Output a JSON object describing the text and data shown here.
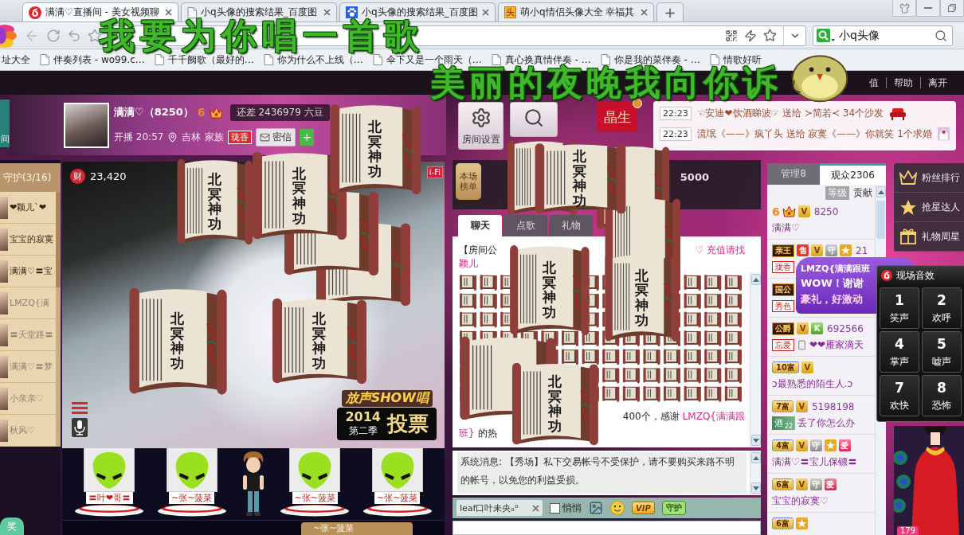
{
  "lyrics": [
    {
      "text": "我要为你唱一首歌"
    },
    {
      "text": "美丽的夜晚我向你诉"
    }
  ],
  "browser": {
    "tabs": [
      {
        "title": "满满♡直播间 - 美女视频聊",
        "kind": "live",
        "selected": true
      },
      {
        "title": "小q头像的搜索结果_百度图",
        "kind": "page",
        "selected": false
      },
      {
        "title": "小q头像的搜索结果_百度图",
        "kind": "paw",
        "selected": false
      },
      {
        "title": "萌小q情侣头像大全 幸福其",
        "kind": "glyph",
        "favicon": "头",
        "selected": false
      }
    ],
    "new_tab": "+",
    "search": {
      "value": "小q头像"
    },
    "bookmarks": [
      {
        "title": "址大全",
        "kind": "plain"
      },
      {
        "title": "伴奏列表 - wo99.c…",
        "kind": "page"
      },
      {
        "title": "千千阙歌（最好的…",
        "kind": "page"
      },
      {
        "title": "你为什么不上线（…",
        "kind": "page"
      },
      {
        "title": "伞下又是一个雨天（…",
        "kind": "page"
      },
      {
        "title": "真心换真情伴奏 - …",
        "kind": "page"
      },
      {
        "title": "你是我的菜伴奏 - …",
        "kind": "page"
      },
      {
        "title": "情歌好听",
        "kind": "page"
      }
    ]
  },
  "nav_links": [
    "值",
    "帮助",
    "离开"
  ],
  "side_tab": "间",
  "host": {
    "name": "满满♡（8250）",
    "level": "6",
    "gap_text": "还差 2436979 六豆",
    "started": "开播 20:57",
    "location": "吉林",
    "family_label": "家族",
    "family_badge": "珑香",
    "message_button": "密信",
    "follow_button": "+"
  },
  "room_buttons": [
    {
      "kind": "settings",
      "label": "房间设置"
    },
    {
      "kind": "search"
    }
  ],
  "star_banner": "晶生",
  "gift_feed": [
    {
      "time": "22:23",
      "text": "☜安迪❤饮酒睇波☞ 送给 ≻简若≺ 34个沙发",
      "kind": "sofa"
    },
    {
      "time": "22:23",
      "text": "流氓《——》疯丫头 送给 寂寞《——》你就笑 1个求婚",
      "kind": "veil"
    }
  ],
  "guards": {
    "title": "守护(3/16)",
    "items": [
      {
        "name": "❤颖儿`❤",
        "online": true
      },
      {
        "name": "宝宝的寂寞",
        "online": true
      },
      {
        "name": "满满♡〓宝",
        "online": true
      },
      {
        "name": "LMZQ{满",
        "online": false
      },
      {
        "name": "〓天堂路〓",
        "online": false
      },
      {
        "name": "满满♡〓梦",
        "online": false
      },
      {
        "name": "小亲亲♡",
        "online": false
      },
      {
        "name": "秋风♡",
        "online": false
      }
    ]
  },
  "award_badge": "奖",
  "video": {
    "wealth_label": "财",
    "wealth": "23,420",
    "wifi_badge": "i-Fi",
    "promo": {
      "title": "放声SHOW唱",
      "year": "2014",
      "season": "第二季",
      "action": "投票"
    }
  },
  "seats": [
    {
      "kind": "alien",
      "name": "〓叶❤哥〓"
    },
    {
      "kind": "alien",
      "name": "~张~菠菜"
    },
    {
      "kind": "character"
    },
    {
      "kind": "alien",
      "name": "~张~菠菜"
    },
    {
      "kind": "alien",
      "name": "~张~菠菜"
    }
  ],
  "hover_name": "~张~菠菜",
  "ranking": {
    "tag": "本场榜单",
    "value": "5000"
  },
  "chat": {
    "tabs": [
      {
        "label": "聊天",
        "selected": true
      },
      {
        "label": "点歌",
        "selected": false
      },
      {
        "label": "礼物",
        "selected": false
      }
    ],
    "notice": {
      "start": "【房间公",
      "end": "♡ 充值请找",
      "next_line": "颖儿"
    },
    "thanks": {
      "text": "400个，感谢",
      "name": "LMZQ{满满跟",
      "name_end": "班}",
      "tail": "的热"
    },
    "system": "系统消息: 【秀场】私下交易帐号不受保护，请不要购买来路不明的帐号，以免您的利益受损。",
    "recipient": "leaf口叶未央ₒ⁰",
    "whisper": {
      "label": "悄悄",
      "checked": false
    },
    "vip_button": "VIP",
    "guard_button": "守护"
  },
  "audience": {
    "tabs": [
      {
        "label": "管理8",
        "selected": false
      },
      {
        "label": "观众2306",
        "selected": true
      }
    ],
    "sort": [
      {
        "label": "等级",
        "selected": true
      },
      {
        "label": "贡献",
        "selected": false
      }
    ],
    "users": [
      {
        "badges": [
          {
            "kind": "crown",
            "text": "6"
          },
          {
            "kind": "vip",
            "text": "V"
          }
        ],
        "score": "8250",
        "name": "满满♡"
      },
      {
        "badges": [
          {
            "kind": "noble",
            "text": "亲王"
          },
          {
            "kind": "sell",
            "text": "售"
          },
          {
            "kind": "vip",
            "text": "V"
          },
          {
            "kind": "guard",
            "text": "守"
          },
          {
            "kind": "star"
          }
        ],
        "score": "21",
        "tags": [
          {
            "kind": "family",
            "text": "珑香"
          }
        ]
      },
      {
        "badges": [
          {
            "kind": "noble",
            "text": "国公"
          }
        ],
        "tags": [
          {
            "kind": "family",
            "text": "秀色"
          }
        ]
      },
      {
        "badges": [
          {
            "kind": "noble",
            "text": "公爵"
          },
          {
            "kind": "vip",
            "text": "V"
          },
          {
            "kind": "k",
            "text": "K"
          }
        ],
        "score": "692566",
        "tags": [
          {
            "kind": "family",
            "text": "忘爱"
          },
          {
            "kind": "phone"
          }
        ],
        "name": "❤❤雁家滴天"
      },
      {
        "badges": [
          {
            "kind": "rich",
            "text": "10富"
          },
          {
            "kind": "vip",
            "text": "V"
          }
        ],
        "name": "ↄ最熟悉的陌生人.ↄ"
      },
      {
        "badges": [
          {
            "kind": "rich",
            "text": "7富"
          },
          {
            "kind": "vip",
            "text": "V"
          }
        ],
        "score": "5198198",
        "tags": [
          {
            "kind": "card",
            "text": "酒",
            "count": "22"
          }
        ],
        "name": "丢了你怎么办"
      },
      {
        "badges": [
          {
            "kind": "rich",
            "text": "4富"
          },
          {
            "kind": "vip",
            "text": "V"
          },
          {
            "kind": "guard",
            "text": "守"
          },
          {
            "kind": "star"
          },
          {
            "kind": "love",
            "text": "爱"
          }
        ],
        "name": "满满♡〓宝儿保镖〓"
      },
      {
        "badges": [
          {
            "kind": "rich",
            "text": "6富"
          },
          {
            "kind": "vip",
            "text": "V"
          },
          {
            "kind": "guard",
            "text": "守"
          },
          {
            "kind": "love",
            "text": "爱"
          }
        ],
        "name": "宝宝的寂寞♡"
      },
      {
        "badges": [
          {
            "kind": "rich",
            "text": "6富"
          },
          {
            "kind": "star"
          }
        ]
      }
    ]
  },
  "bubble": {
    "name": "LMZQ{满满跟班",
    "lines": [
      "WOW！谢谢",
      "豪礼，好激动"
    ]
  },
  "menu": [
    {
      "label": "粉丝排行",
      "kind": "crown"
    },
    {
      "label": "抢星达人",
      "kind": "star"
    },
    {
      "label": "礼物周星",
      "kind": "gift"
    }
  ],
  "sound_panel": {
    "title": "现场音效",
    "buttons": [
      {
        "key": "1",
        "label": "笑声"
      },
      {
        "key": "2",
        "label": "欢呼"
      },
      {
        "key": "4",
        "label": "掌声"
      },
      {
        "key": "5",
        "label": "嘘声"
      },
      {
        "key": "7",
        "label": "欢快"
      },
      {
        "key": "8",
        "label": "恐怖"
      }
    ]
  },
  "count_badge": "179",
  "gift_scrolls": [
    {
      "kind": "blank"
    },
    {
      "kind": "blank"
    },
    {
      "kind": "titled",
      "label": "北冥神功"
    },
    {
      "kind": "titled",
      "label": "北冥神功"
    },
    {
      "kind": "titled",
      "label": "北冥神功"
    },
    {
      "kind": "titled",
      "label": "北冥神功"
    },
    {
      "kind": "titled",
      "label": "北冥神功"
    },
    {
      "kind": "blank"
    },
    {
      "kind": "blank"
    },
    {
      "kind": "blank"
    },
    {
      "kind": "blank"
    },
    {
      "kind": "titled",
      "label": "北冥神功"
    },
    {
      "kind": "titled",
      "label": "北冥神功"
    },
    {
      "kind": "titled",
      "label": "北冥神功"
    },
    {
      "kind": "titled",
      "label": "北冥神功"
    }
  ]
}
